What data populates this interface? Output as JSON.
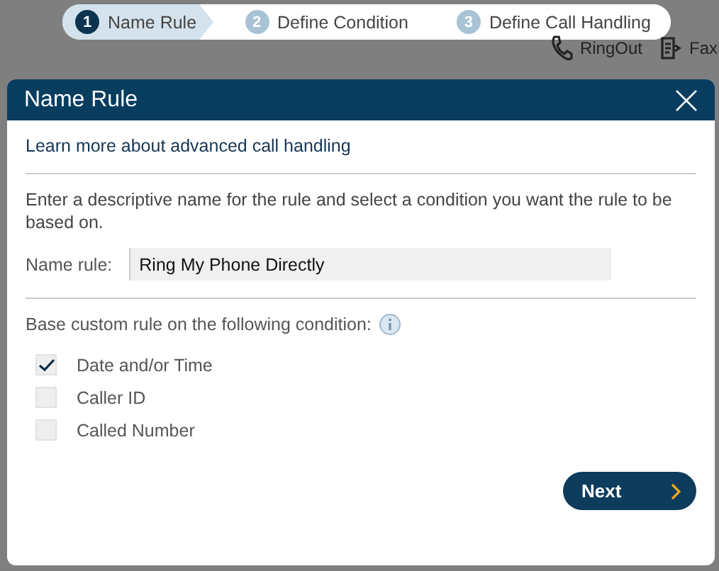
{
  "steps": [
    {
      "number": "1",
      "label": "Name Rule",
      "selected": true
    },
    {
      "number": "2",
      "label": "Define Condition",
      "selected": false
    },
    {
      "number": "3",
      "label": "Define Call Handling",
      "selected": false
    }
  ],
  "toolbar": [
    {
      "kind": "phone",
      "label": "RingOut"
    },
    {
      "kind": "fax",
      "label": "Fax"
    }
  ],
  "dialog": {
    "title": "Name Rule",
    "link": "Learn more about advanced call handling",
    "intro": "Enter a descriptive name for the rule and select a condition you want the rule to be based on.",
    "name_field": {
      "label": "Name rule:",
      "value": "Ring My Phone Directly"
    },
    "condition_heading": "Base custom rule on the following condition:",
    "conditions": [
      {
        "label": "Date and/or Time",
        "checked": true
      },
      {
        "label": "Caller ID",
        "checked": false
      },
      {
        "label": "Called Number",
        "checked": false
      }
    ],
    "next_button": "Next"
  }
}
